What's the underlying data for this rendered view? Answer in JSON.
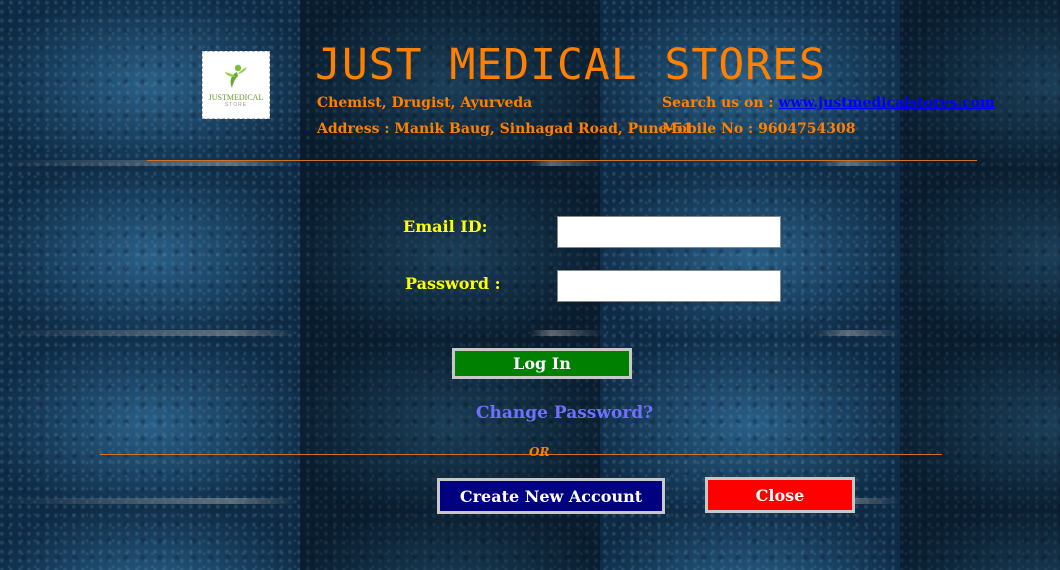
{
  "header": {
    "title": "JUST MEDICAL STORES",
    "tagline": "Chemist, Drugist, Ayurveda",
    "address": "Address : Manik Baug, Sinhagad Road, Pune-51",
    "search_label": "Search us on :",
    "website": "www.justmedicalstores.com",
    "mobile": "Mobile No : 9604754308",
    "logo_text": "JUSTMEDICAL",
    "logo_sub": "STORE"
  },
  "form": {
    "email_label": "Email ID:",
    "email_value": "",
    "password_label": "Password :",
    "password_value": ""
  },
  "actions": {
    "login_label": "Log In",
    "change_password_label": "Change Password?",
    "or_label": "OR",
    "create_account_label": "Create New Account",
    "close_label": "Close"
  },
  "colors": {
    "accent": "#ff8000",
    "label": "#ffff00",
    "login_bg": "#008000",
    "create_bg": "#000080",
    "close_bg": "#ff0000",
    "link": "#0000ff"
  }
}
